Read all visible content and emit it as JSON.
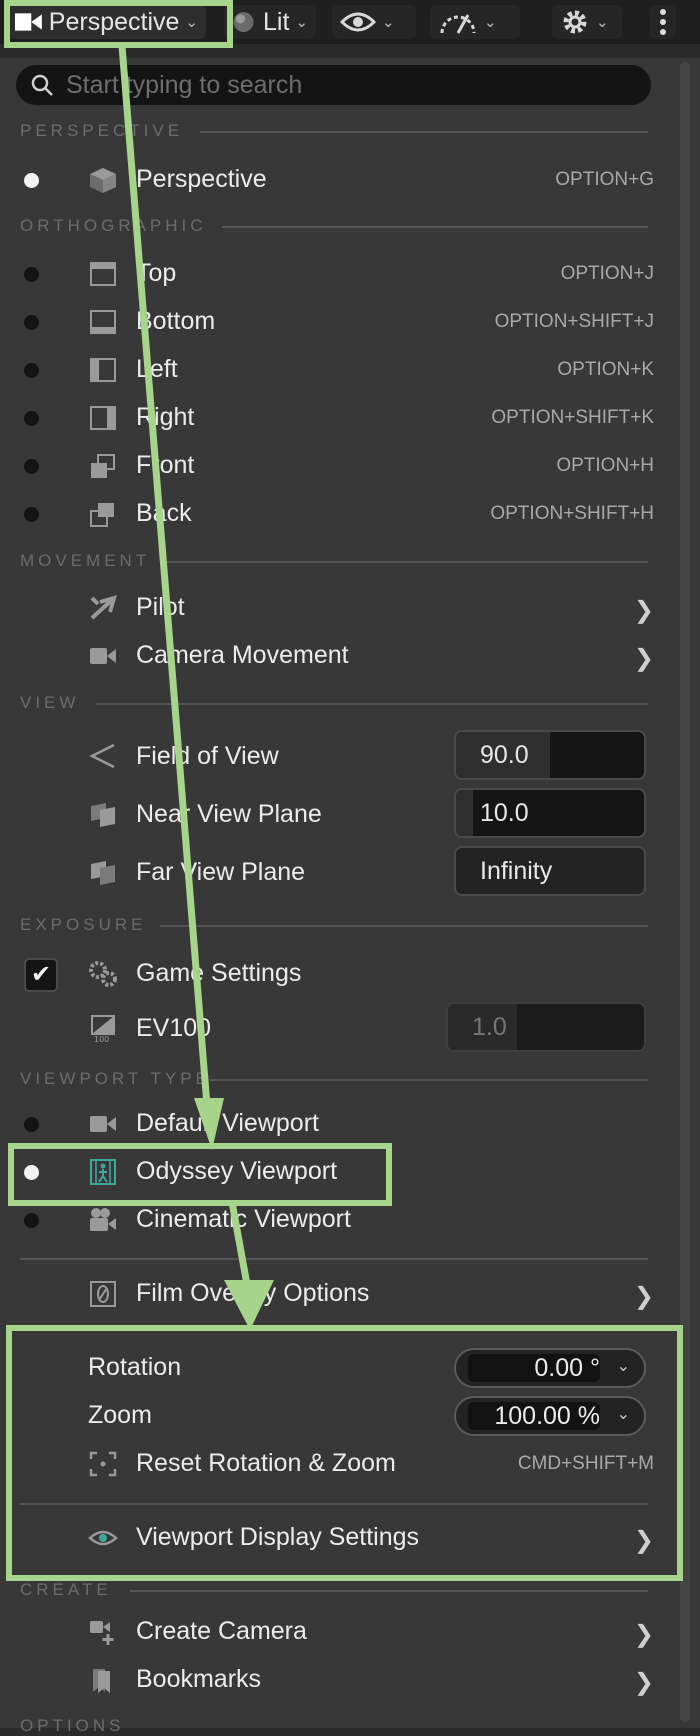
{
  "toolbar": {
    "perspective_label": "Perspective",
    "lit_label": "Lit"
  },
  "search": {
    "placeholder": "Start typing to search"
  },
  "sections": {
    "perspective": "PERSPECTIVE",
    "orthographic": "ORTHOGRAPHIC",
    "movement": "MOVEMENT",
    "view": "VIEW",
    "exposure": "EXPOSURE",
    "viewport_type": "VIEWPORT TYPE",
    "create": "CREATE",
    "options": "OPTIONS"
  },
  "items": {
    "perspective": {
      "label": "Perspective",
      "shortcut": "OPTION+G"
    },
    "top": {
      "label": "Top",
      "shortcut": "OPTION+J"
    },
    "bottom": {
      "label": "Bottom",
      "shortcut": "OPTION+SHIFT+J"
    },
    "left": {
      "label": "Left",
      "shortcut": "OPTION+K"
    },
    "right": {
      "label": "Right",
      "shortcut": "OPTION+SHIFT+K"
    },
    "front": {
      "label": "Front",
      "shortcut": "OPTION+H"
    },
    "back": {
      "label": "Back",
      "shortcut": "OPTION+SHIFT+H"
    },
    "pilot": {
      "label": "Pilot"
    },
    "camera_movement": {
      "label": "Camera Movement"
    },
    "fov": {
      "label": "Field of View",
      "value": "90.0",
      "slider": 0.5
    },
    "near": {
      "label": "Near View Plane",
      "value": "10.0",
      "slider": 0.09
    },
    "far": {
      "label": "Far View Plane",
      "value": "Infinity"
    },
    "game_settings": {
      "label": "Game Settings",
      "checked": true
    },
    "ev100": {
      "label": "EV100",
      "value": "1.0",
      "slider": 0.35
    },
    "default_viewport": {
      "label": "Default Viewport"
    },
    "odyssey_viewport": {
      "label": "Odyssey Viewport"
    },
    "cinematic_viewport": {
      "label": "Cinematic Viewport"
    },
    "film_overlay": {
      "label": "Film Overlay Options"
    },
    "rotation": {
      "label": "Rotation",
      "value": "0.00 °"
    },
    "zoom": {
      "label": "Zoom",
      "value": "100.00 %"
    },
    "reset": {
      "label": "Reset Rotation & Zoom",
      "shortcut": "CMD+SHIFT+M"
    },
    "display_settings": {
      "label": "Viewport Display Settings"
    },
    "create_camera": {
      "label": "Create Camera"
    },
    "bookmarks": {
      "label": "Bookmarks"
    }
  },
  "colors": {
    "highlight": "#a6d48a",
    "menu_bg": "#383838",
    "toolbar_bg": "#1f1f1f",
    "accent_teal": "#3fa89a"
  }
}
